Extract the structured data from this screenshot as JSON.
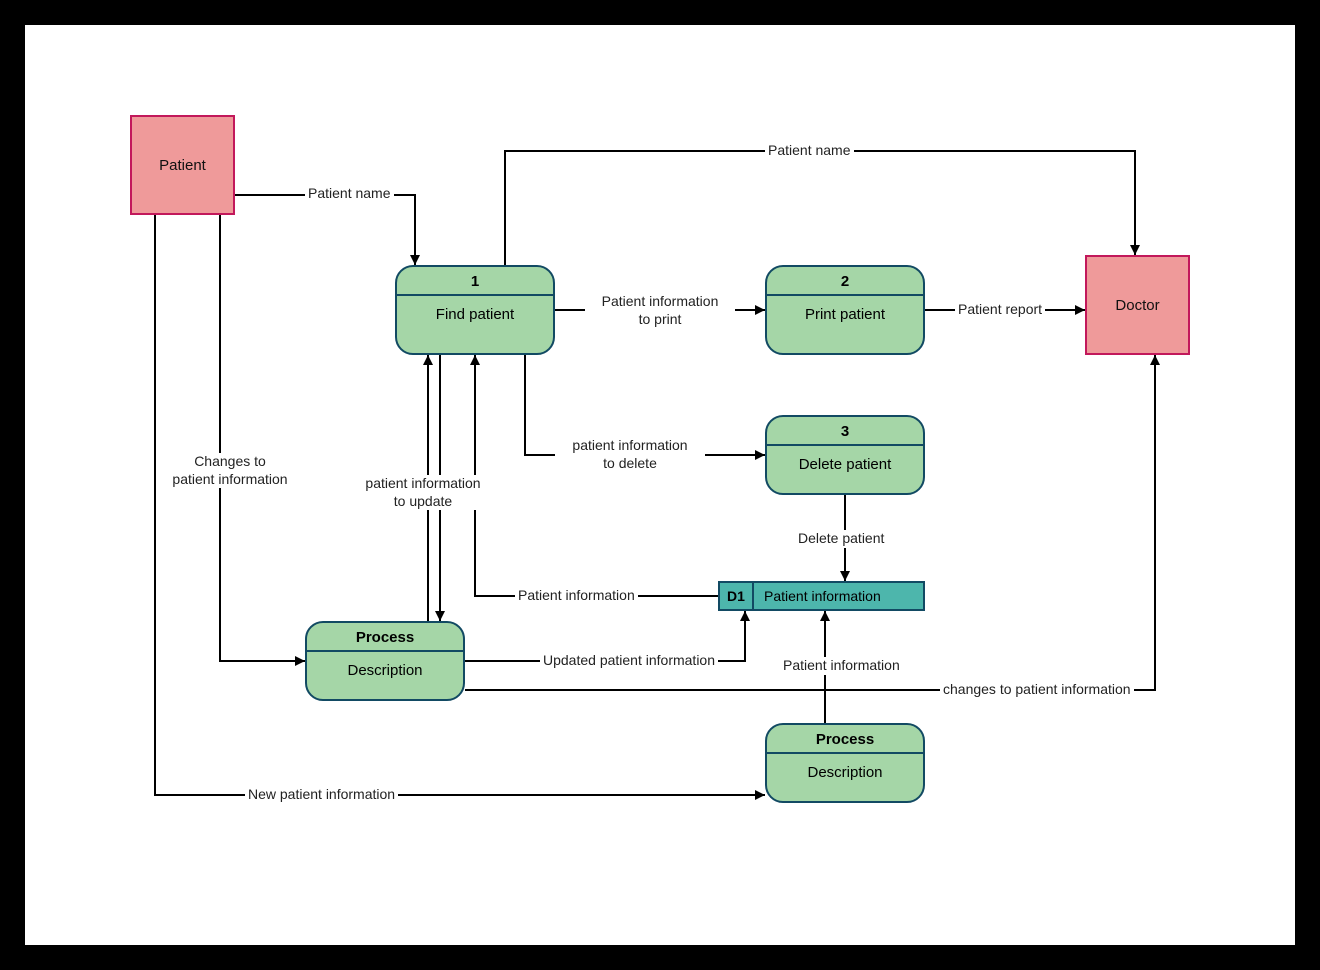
{
  "entities": {
    "patient": "Patient",
    "doctor": "Doctor"
  },
  "processes": {
    "p1": {
      "num": "1",
      "title": "Find patient"
    },
    "p2": {
      "num": "2",
      "title": "Print patient"
    },
    "p3": {
      "num": "3",
      "title": "Delete patient"
    },
    "p4": {
      "num": "Process",
      "title": "Description"
    },
    "p5": {
      "num": "Process",
      "title": "Description"
    }
  },
  "datastore": {
    "d1": {
      "id": "D1",
      "label": "Patient information"
    }
  },
  "labels": {
    "l_patient_name_1": "Patient name",
    "l_patient_name_2": "Patient name",
    "l_info_print": "Patient information\nto print",
    "l_patient_report": "Patient report",
    "l_info_delete": "patient information\nto delete",
    "l_info_update": "patient information\nto update",
    "l_changes": "Changes to\npatient information",
    "l_changes2": "changes to patient information",
    "l_delete_patient": "Delete patient",
    "l_patient_info": "Patient information",
    "l_patient_info2": "Patient information",
    "l_updated_info": "Updated patient information",
    "l_new_patient": "New patient information"
  },
  "colors": {
    "entity_fill": "#ef9a9a",
    "entity_border": "#c2185b",
    "process_fill": "#a5d6a7",
    "process_border": "#124a63",
    "datastore_fill": "#4db6ac",
    "arrow": "#000000"
  }
}
